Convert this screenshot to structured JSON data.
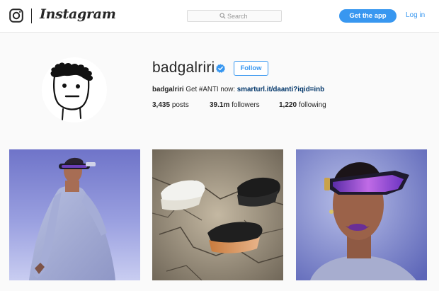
{
  "header": {
    "brand": "Instagram",
    "search_placeholder": "Search",
    "get_app_label": "Get the app",
    "login_label": "Log in"
  },
  "profile": {
    "username": "badgalriri",
    "verified": true,
    "follow_label": "Follow",
    "bio_name": "badgalriri",
    "bio_text": " Get #ANTI now: ",
    "bio_link": "smarturl.it/daanti?iqid=inb",
    "stats": [
      {
        "value": "3,435",
        "label": "posts"
      },
      {
        "value": "39.1m",
        "label": "followers"
      },
      {
        "value": "1,220",
        "label": "following"
      }
    ]
  },
  "posts": [
    {
      "subject": "woman-in-grey-knit-dress-with-visor-sunglasses"
    },
    {
      "subject": "three-sneakers-on-cracked-mud"
    },
    {
      "subject": "closeup-with-purple-visor-sunglasses"
    }
  ],
  "colors": {
    "accent": "#3897f0",
    "link": "#003569",
    "background": "#fafafa",
    "text": "#262626"
  },
  "icons": [
    "instagram-glyph-icon",
    "search-icon",
    "verified-badge-icon"
  ]
}
